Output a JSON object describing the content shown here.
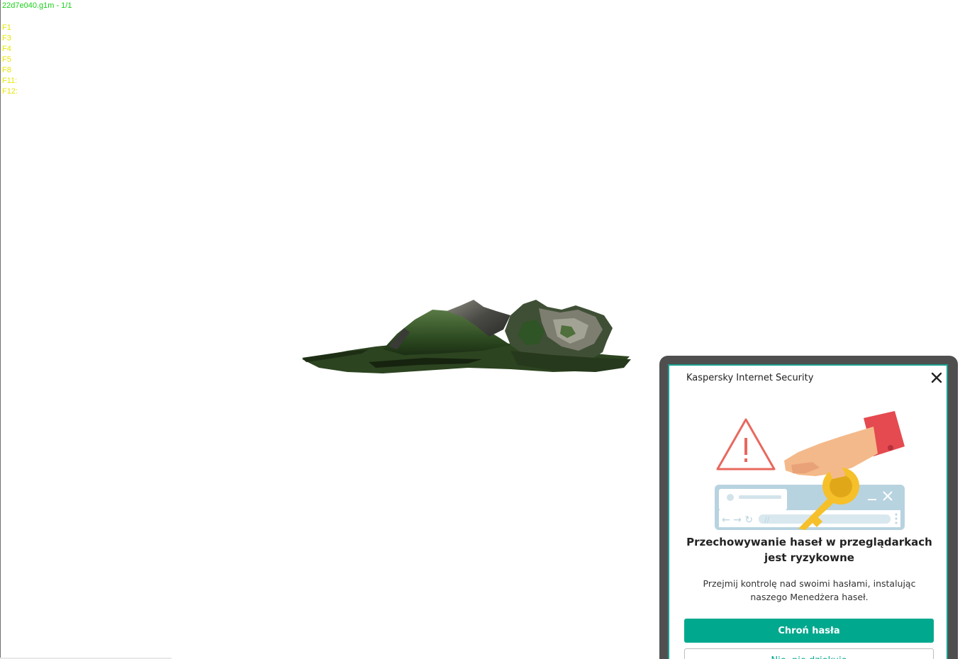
{
  "viewer": {
    "title": "22d7e040.g1m - 1/1",
    "function_keys": [
      "F1",
      "F3",
      "F4",
      "F5",
      "F8",
      "F11:",
      "F12:"
    ],
    "colors": {
      "title": "#18d018",
      "function_keys": "#e6e600",
      "background": "#ffffff"
    }
  },
  "popup": {
    "product_name": "Kaspersky Internet Security",
    "heading": "Przechowywanie haseł w przeglądarkach jest ryzykowne",
    "body": "Przejmij kontrolę nad swoimi hasłami, instalując naszego Menedżera haseł.",
    "primary_button": "Chroń hasła",
    "secondary_button": "Nie, nie dziękuję",
    "illustration": "warning-triangle, hand-holding-key, browser-window",
    "colors": {
      "accent": "#00a88e",
      "border": "#1aa090",
      "frame": "#4f4f4f"
    }
  }
}
